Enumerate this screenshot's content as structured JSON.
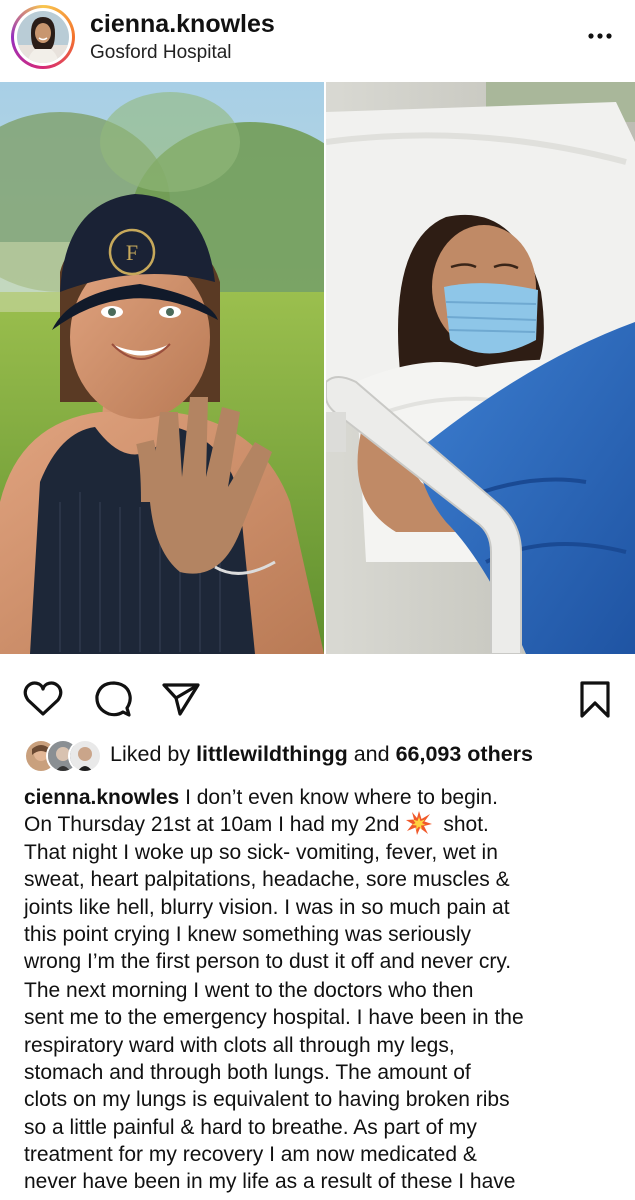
{
  "post": {
    "username": "cienna.knowles",
    "location": "Gosford Hospital"
  },
  "icons": {
    "more": "more-dots-icon",
    "like": "heart-icon",
    "comment": "comment-icon",
    "share": "send-icon",
    "save": "bookmark-icon",
    "caption_emoji": "collision-emoji-icon"
  },
  "likes": {
    "prefix": "Liked by ",
    "user": "littlewildthingg",
    "middle": " and ",
    "count": "66,093 others"
  },
  "caption": {
    "username": "cienna.knowles",
    "lines": [
      " I don’t even know where to begin.",
      "On Thursday 21st at 10am I had my 2nd",
      " shot.",
      "That night I woke up so sick- vomiting, fever, wet in",
      "sweat, heart palpitations, headache, sore muscles &",
      "joints like hell, blurry vision. I was in so much pain at",
      "this point crying I knew something was seriously",
      "wrong I’m the first person to dust it off and never cry.",
      "The next morning I went to the doctors who then",
      "sent me to the emergency hospital. I have been in the",
      "respiratory ward with clots all through my legs,",
      "stomach and through both lungs. The amount of",
      "clots on my lungs is equivalent to having broken ribs",
      "so a little painful & hard to breathe. As part of my",
      "treatment for my recovery I am now medicated &",
      "never have been in my life as a result of these I have"
    ]
  },
  "colors": {
    "text": "#111111",
    "background": "#ffffff",
    "ring_start": "#f9c74f",
    "ring_end": "#962fbf",
    "blanket": "#2f6fc4"
  }
}
